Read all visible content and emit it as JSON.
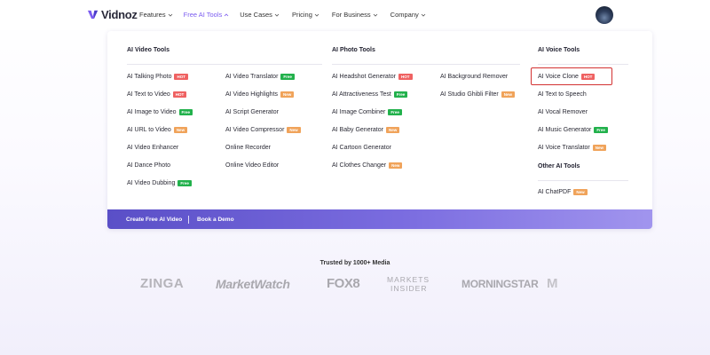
{
  "brand": {
    "name": "Vidnoz"
  },
  "nav": {
    "items": [
      {
        "label": "Features"
      },
      {
        "label": "Free AI Tools",
        "active": true
      },
      {
        "label": "Use Cases"
      },
      {
        "label": "Pricing"
      },
      {
        "label": "For Business"
      },
      {
        "label": "Company"
      }
    ]
  },
  "dropdown": {
    "video": {
      "title": "AI Video Tools",
      "col1": [
        {
          "label": "AI Talking Photo",
          "badge": "HOT"
        },
        {
          "label": "AI Text to Video",
          "badge": "HOT"
        },
        {
          "label": "AI Image to Video",
          "badge": "Free"
        },
        {
          "label": "AI URL to Video",
          "badge": "New"
        },
        {
          "label": "AI Video Enhancer",
          "badge": ""
        },
        {
          "label": "AI Dance Photo",
          "badge": ""
        },
        {
          "label": "AI Video Dubbing",
          "badge": "Free"
        }
      ],
      "col2": [
        {
          "label": "AI Video Translator",
          "badge": "Free"
        },
        {
          "label": "AI Video Highlights",
          "badge": "New"
        },
        {
          "label": "AI Script Generator",
          "badge": ""
        },
        {
          "label": "AI Video Compressor",
          "badge": "New"
        },
        {
          "label": "Online Recorder",
          "badge": ""
        },
        {
          "label": "Online Video Editor",
          "badge": ""
        }
      ]
    },
    "photo": {
      "title": "AI Photo Tools",
      "col1": [
        {
          "label": "AI Headshot Generator",
          "badge": "HOT"
        },
        {
          "label": "AI Attractiveness Test",
          "badge": "Free"
        },
        {
          "label": "AI Image Combiner",
          "badge": "Free"
        },
        {
          "label": "AI Baby Generator",
          "badge": "New"
        },
        {
          "label": "AI Cartoon Generator",
          "badge": ""
        },
        {
          "label": "AI Clothes Changer",
          "badge": "New"
        }
      ],
      "col2": [
        {
          "label": "AI Background Remover",
          "badge": ""
        },
        {
          "label": "AI Studio Ghibli Filter",
          "badge": "New"
        }
      ]
    },
    "voice": {
      "title": "AI Voice Tools",
      "items": [
        {
          "label": "AI Voice Clone",
          "badge": "HOT",
          "highlighted": true
        },
        {
          "label": "AI Text to Speech",
          "badge": ""
        },
        {
          "label": "AI Vocal Remover",
          "badge": ""
        },
        {
          "label": "AI Music Generator",
          "badge": "Free"
        },
        {
          "label": "AI Voice Translator",
          "badge": "New"
        }
      ]
    },
    "other": {
      "title": "Other AI Tools",
      "items": [
        {
          "label": "AI ChatPDF",
          "badge": "New"
        }
      ]
    },
    "footer": {
      "create": "Create Free AI Video",
      "demo": "Book a Demo"
    }
  },
  "trusted": {
    "text": "Trusted by 1000+ Media",
    "logos": [
      "ZINGA",
      "MarketWatch",
      "FOX8",
      "MARKETS",
      "INSIDER",
      "MORNINGSTAR",
      "M"
    ]
  },
  "colors": {
    "accent": "#7b5cf0",
    "hot": "#ef6262",
    "free": "#22b14c",
    "new": "#f0a35a",
    "highlight": "#d33232"
  },
  "icons": {
    "chevron": "chevron-down-icon",
    "logo": "vidnoz-logo-icon",
    "avatar": "avatar"
  }
}
